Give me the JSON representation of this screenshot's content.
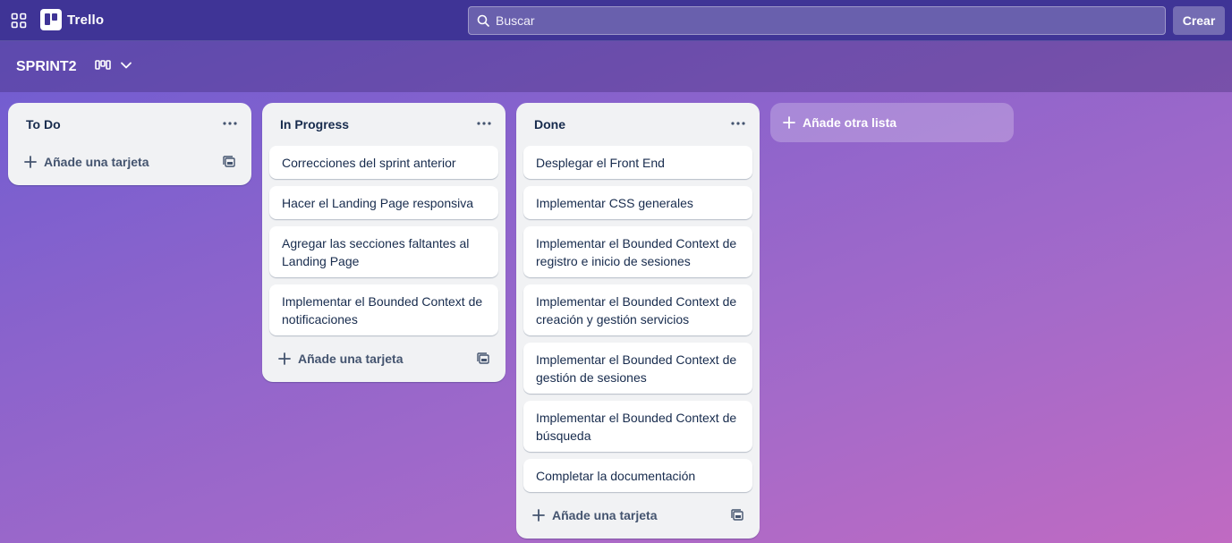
{
  "topbar": {
    "app_name": "Trello",
    "search_placeholder": "Buscar",
    "create_label": "Crear"
  },
  "board": {
    "title": "SPRINT2"
  },
  "lists": [
    {
      "title": "To Do",
      "cards": [],
      "add_card_label": "Añade una tarjeta"
    },
    {
      "title": "In Progress",
      "cards": [
        "Correcciones del sprint anterior",
        "Hacer el Landing Page responsiva",
        "Agregar las secciones faltantes al Landing Page",
        "Implementar el Bounded Context de notificaciones"
      ],
      "add_card_label": "Añade una tarjeta"
    },
    {
      "title": "Done",
      "cards": [
        "Desplegar el Front End",
        "Implementar CSS generales",
        "Implementar el Bounded Context de registro e inicio de sesiones",
        "Implementar el Bounded Context de creación y gestión servicios",
        "Implementar el Bounded Context de gestión de sesiones",
        "Implementar el Bounded Context de búsqueda",
        "Completar la documentación"
      ],
      "add_card_label": "Añade una tarjeta"
    }
  ],
  "add_list_label": "Añade otra lista",
  "icons": [
    "apps-grid-icon",
    "trello-logo-icon",
    "search-icon",
    "board-view-icon",
    "chevron-down-icon",
    "more-horizontal-icon",
    "plus-icon",
    "card-template-icon"
  ],
  "colors": {
    "topbar": "#3f3496",
    "list_bg": "#f1f2f4",
    "text": "#172b4d"
  }
}
